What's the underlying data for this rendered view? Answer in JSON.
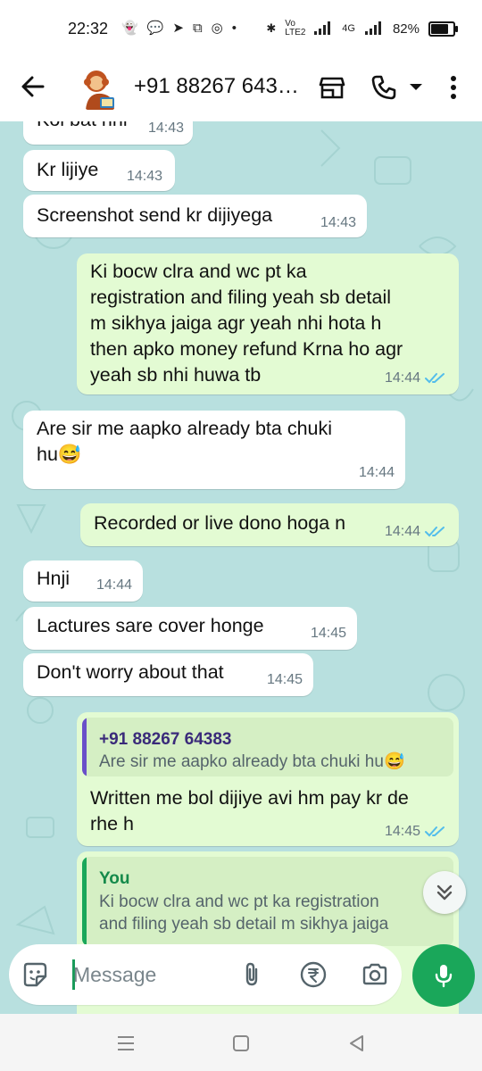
{
  "status_bar": {
    "time": "22:32",
    "network_label": "Vo LTE2",
    "signal_label": "4G",
    "battery_percent": "82%"
  },
  "header": {
    "title": "+91 88267 643…",
    "icons": [
      "back-arrow-icon",
      "shop-icon",
      "phone-icon",
      "dropdown-caret-icon",
      "more-vertical-icon"
    ]
  },
  "messages": [
    {
      "direction": "in",
      "text": "Koi bat nhi",
      "time": "14:43"
    },
    {
      "direction": "in",
      "text": "Kr lijiye",
      "time": "14:43"
    },
    {
      "direction": "in",
      "text": "Screenshot send kr dijiyega",
      "time": "14:43"
    },
    {
      "direction": "out",
      "lines": [
        "Ki bocw clra and wc pt ka",
        "registration and filing yeah sb detail",
        "m sikhya jaiga agr yeah nhi hota h",
        "then apko money refund Krna ho agr",
        "yeah sb nhi huwa tb"
      ],
      "time": "14:44",
      "status": "read"
    },
    {
      "direction": "in",
      "lines": [
        "Are sir me aapko already bta chuki",
        "hu😅"
      ],
      "time": "14:44"
    },
    {
      "direction": "out",
      "text": "Recorded or live dono hoga n",
      "time": "14:44",
      "status": "read"
    },
    {
      "direction": "in",
      "text": "Hnji",
      "time": "14:44"
    },
    {
      "direction": "in",
      "text": "Lactures sare cover honge",
      "time": "14:45"
    },
    {
      "direction": "in",
      "text": "Don't worry about that",
      "time": "14:45"
    },
    {
      "direction": "out",
      "quote": {
        "name": "+91 88267 64383",
        "text": "Are sir me aapko already bta chuki hu😅"
      },
      "lines": [
        "Written me bol dijiye avi hm pay kr de",
        "rhe h"
      ],
      "time": "14:45",
      "status": "read"
    },
    {
      "direction": "out",
      "quote": {
        "name": "You",
        "lines": [
          "Ki bocw clra and wc pt ka registration",
          "and filing yeah sb detail m sikhya jaiga"
        ]
      }
    }
  ],
  "composer": {
    "placeholder": "Message",
    "icons": [
      "sticker-icon",
      "attach-icon",
      "rupee-payment-icon",
      "camera-icon",
      "mic-icon"
    ]
  },
  "colors": {
    "chat_background": "#b8e0df",
    "incoming_bubble": "#ffffff",
    "outgoing_bubble": "#e3fbd3",
    "read_ticks": "#53bdeb",
    "accent_green": "#1aa75a",
    "quote_bar_contact": "#6a4fc9",
    "quote_bar_self": "#1aa75a",
    "quote_name_self": "#158a4b",
    "quote_name_contact": "#3a2a7a"
  }
}
